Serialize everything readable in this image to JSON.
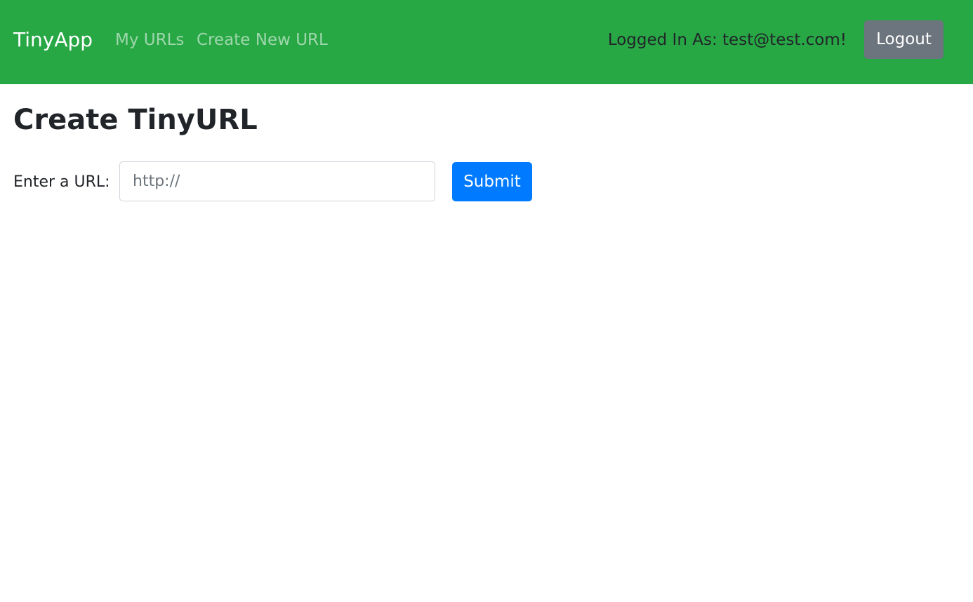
{
  "navbar": {
    "brand": "TinyApp",
    "links": [
      {
        "label": "My URLs"
      },
      {
        "label": "Create New URL"
      }
    ],
    "user_text": "Logged In As: test@test.com!",
    "logout_label": "Logout",
    "background_color": "#28a745"
  },
  "main": {
    "title": "Create TinyURL",
    "form": {
      "label": "Enter a URL:",
      "input_value": "",
      "input_placeholder": "http://",
      "submit_label": "Submit",
      "submit_color": "#007bff"
    }
  },
  "colors": {
    "logout_button": "#6c757d",
    "text": "#212529"
  }
}
